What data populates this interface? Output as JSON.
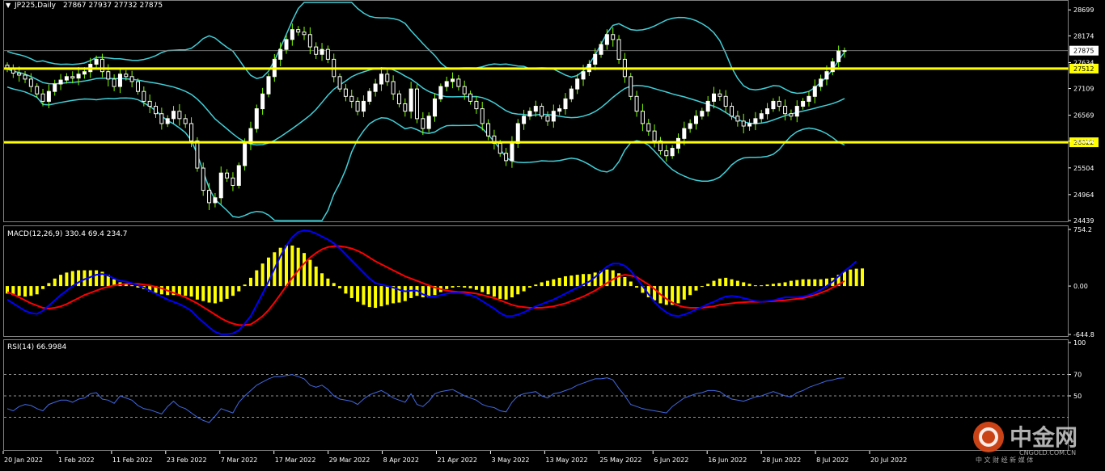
{
  "header": {
    "symbol": "JP225,Daily",
    "ohlc": "27867 27937 27732 27875",
    "macd_label": "MACD(12,26,9) 330.4 69.4 234.7",
    "rsi_label": "RSI(14) 66.9984"
  },
  "price_axis": {
    "ticks": [
      "28699",
      "28174",
      "27634",
      "27109",
      "26569",
      "26044",
      "25504",
      "24964",
      "24439"
    ],
    "current_price_label": "27875",
    "level_labels": [
      "27512",
      "26022"
    ]
  },
  "macd_axis": {
    "ticks": [
      "754.2",
      "0.00",
      "-644.8"
    ]
  },
  "rsi_axis": {
    "ticks": [
      "100",
      "70",
      "50"
    ]
  },
  "date_axis": {
    "labels": [
      "20 Jan 2022",
      "1 Feb 2022",
      "11 Feb 2022",
      "23 Feb 2022",
      "7 Mar 2022",
      "17 Mar 2022",
      "29 Mar 2022",
      "8 Apr 2022",
      "21 Apr 2022",
      "3 May 2022",
      "13 May 2022",
      "25 May 2022",
      "6 Jun 2022",
      "16 Jun 2022",
      "28 Jun 2022",
      "8 Jul 2022",
      "20 Jul 2022"
    ]
  },
  "watermark": {
    "brand": "中金网",
    "domain": "CNGOLD.COM.CN",
    "slogan": "中 文 财 经 新 媒 体"
  },
  "colors": {
    "background": "#000000",
    "bull": "#ffffff",
    "bear": "#ffffff",
    "wick": "#7fff00",
    "bollinger": "#40d0d8",
    "level_line": "#ffff00",
    "macd_hist": "#ffff00",
    "macd_line": "#0000ff",
    "signal_line": "#ff0000",
    "rsi_line": "#4169e1"
  },
  "chart_data": [
    {
      "type": "candlestick",
      "title": "JP225,Daily",
      "x_range": [
        "2022-01-20",
        "2022-07-22"
      ],
      "ylim": [
        24439,
        28850
      ],
      "horizontal_levels": [
        27512,
        26022
      ],
      "current_price": 27875,
      "last_bar": {
        "open": 27867,
        "high": 27937,
        "low": 27732,
        "close": 27875
      },
      "series": [
        {
          "name": "Close",
          "values": [
            27500,
            27420,
            27380,
            27300,
            27150,
            27000,
            26850,
            27050,
            27200,
            27280,
            27350,
            27320,
            27400,
            27450,
            27600,
            27700,
            27450,
            27300,
            27150,
            27400,
            27350,
            27250,
            27050,
            26850,
            26750,
            26600,
            26400,
            26500,
            26650,
            26500,
            26400,
            26050,
            25500,
            25050,
            24800,
            24900,
            25400,
            25300,
            25150,
            25550,
            26000,
            26300,
            26700,
            27000,
            27350,
            27700,
            27900,
            28100,
            28300,
            28250,
            28200,
            27950,
            27800,
            27900,
            27700,
            27350,
            27100,
            26950,
            26850,
            26650,
            26850,
            27050,
            27200,
            27400,
            27250,
            27000,
            26800,
            26650,
            27100,
            26500,
            26300,
            26550,
            26900,
            27150,
            27250,
            27300,
            27150,
            27000,
            26850,
            26700,
            26400,
            26150,
            26000,
            25800,
            25650,
            26000,
            26400,
            26550,
            26650,
            26750,
            26550,
            26450,
            26650,
            26700,
            26900,
            27100,
            27300,
            27450,
            27600,
            27800,
            28000,
            28200,
            28100,
            27700,
            27350,
            26950,
            26650,
            26400,
            26250,
            26050,
            25850,
            25750,
            25900,
            26100,
            26300,
            26400,
            26550,
            26650,
            26850,
            27000,
            26950,
            26750,
            26550,
            26450,
            26350,
            26400,
            26500,
            26600,
            26700,
            26850,
            26750,
            26600,
            26550,
            26750,
            26850,
            26950,
            27150,
            27300,
            27450,
            27650,
            27867,
            27875
          ]
        }
      ],
      "bollinger": {
        "period": 20,
        "deviations": 2
      }
    },
    {
      "type": "bar+line",
      "title": "MACD(12,26,9) 330.4 69.4 234.7",
      "ylim": [
        -644.8,
        754.2
      ],
      "series": [
        {
          "name": "MACD",
          "values": [
            -180,
            -230,
            -280,
            -330,
            -360,
            -370,
            -330,
            -260,
            -190,
            -120,
            -60,
            0,
            50,
            90,
            120,
            150,
            160,
            140,
            100,
            70,
            60,
            40,
            10,
            -20,
            -60,
            -100,
            -140,
            -180,
            -210,
            -240,
            -280,
            -330,
            -410,
            -480,
            -550,
            -610,
            -640,
            -640,
            -630,
            -590,
            -500,
            -400,
            -250,
            -100,
            60,
            230,
            400,
            540,
            650,
            720,
            740,
            730,
            700,
            660,
            620,
            570,
            500,
            420,
            340,
            260,
            180,
            100,
            40,
            20,
            0,
            -20,
            -50,
            -70,
            -60,
            -60,
            -110,
            -140,
            -140,
            -120,
            -100,
            -90,
            -90,
            -100,
            -120,
            -150,
            -200,
            -250,
            -300,
            -360,
            -400,
            -400,
            -380,
            -350,
            -310,
            -270,
            -240,
            -210,
            -180,
            -140,
            -100,
            -60,
            -20,
            20,
            60,
            120,
            190,
            260,
            300,
            300,
            270,
            200,
            100,
            0,
            -110,
            -210,
            -290,
            -350,
            -390,
            -400,
            -380,
            -350,
            -310,
            -280,
            -240,
            -210,
            -170,
            -140,
            -130,
            -140,
            -160,
            -180,
            -200,
            -210,
            -200,
            -190,
            -170,
            -150,
            -150,
            -150,
            -140,
            -120,
            -90,
            -50,
            0,
            60,
            130,
            200,
            260,
            330
          ]
        },
        {
          "name": "Signal",
          "values": [
            -80,
            -110,
            -150,
            -190,
            -230,
            -260,
            -290,
            -300,
            -290,
            -270,
            -240,
            -200,
            -160,
            -120,
            -90,
            -60,
            -30,
            -10,
            10,
            20,
            30,
            30,
            30,
            20,
            10,
            -10,
            -30,
            -60,
            -90,
            -120,
            -150,
            -190,
            -230,
            -280,
            -330,
            -380,
            -430,
            -470,
            -500,
            -520,
            -520,
            -510,
            -460,
            -400,
            -320,
            -220,
            -110,
            0,
            110,
            210,
            300,
            380,
            440,
            490,
            520,
            530,
            530,
            520,
            500,
            470,
            430,
            380,
            330,
            290,
            250,
            210,
            170,
            130,
            100,
            70,
            40,
            10,
            -20,
            -40,
            -60,
            -70,
            -80,
            -80,
            -90,
            -100,
            -120,
            -140,
            -160,
            -190,
            -220,
            -250,
            -270,
            -280,
            -290,
            -290,
            -290,
            -280,
            -270,
            -250,
            -230,
            -200,
            -170,
            -140,
            -100,
            -60,
            -10,
            40,
            90,
            130,
            150,
            140,
            120,
            70,
            20,
            -40,
            -110,
            -170,
            -220,
            -260,
            -280,
            -290,
            -290,
            -290,
            -280,
            -270,
            -250,
            -240,
            -230,
            -220,
            -215,
            -210,
            -210,
            -210,
            -205,
            -200,
            -195,
            -190,
            -180,
            -170,
            -160,
            -140,
            -120,
            -90,
            -60,
            -20,
            20,
            69
          ]
        },
        {
          "name": "Histogram",
          "values": [
            -100,
            -120,
            -130,
            -140,
            -130,
            -110,
            -40,
            40,
            100,
            150,
            180,
            200,
            210,
            210,
            210,
            210,
            190,
            150,
            90,
            50,
            30,
            10,
            -20,
            -40,
            -70,
            -90,
            -110,
            -120,
            -120,
            -120,
            -130,
            -140,
            -180,
            -200,
            -220,
            -230,
            -210,
            -170,
            -130,
            -70,
            20,
            110,
            210,
            300,
            380,
            450,
            510,
            540,
            540,
            510,
            440,
            350,
            260,
            170,
            100,
            40,
            -30,
            -100,
            -160,
            -210,
            -250,
            -280,
            -290,
            -270,
            -250,
            -230,
            -220,
            -200,
            -160,
            -130,
            -150,
            -150,
            -120,
            -80,
            -40,
            -20,
            -10,
            -20,
            -30,
            -50,
            -80,
            -110,
            -140,
            -170,
            -180,
            -150,
            -110,
            -70,
            -20,
            20,
            50,
            70,
            90,
            110,
            130,
            140,
            150,
            160,
            160,
            180,
            200,
            220,
            210,
            170,
            120,
            60,
            -20,
            -90,
            -150,
            -190,
            -230,
            -250,
            -250,
            -230,
            -180,
            -120,
            -60,
            -10,
            30,
            70,
            100,
            110,
            90,
            70,
            50,
            30,
            10,
            10,
            20,
            30,
            40,
            50,
            70,
            80,
            90,
            90,
            90,
            90,
            100,
            110,
            150,
            190,
            220,
            231,
            234.7
          ]
        }
      ]
    },
    {
      "type": "line",
      "title": "RSI(14) 66.9984",
      "ylim": [
        0,
        100
      ],
      "reference_lines": [
        70,
        50,
        30
      ],
      "series": [
        {
          "name": "RSI",
          "values": [
            38,
            36,
            40,
            42,
            41,
            38,
            36,
            42,
            44,
            46,
            46,
            44,
            47,
            48,
            52,
            53,
            47,
            46,
            43,
            50,
            48,
            46,
            41,
            38,
            37,
            35,
            33,
            40,
            45,
            40,
            38,
            34,
            30,
            27,
            25,
            31,
            38,
            36,
            34,
            44,
            50,
            55,
            60,
            63,
            66,
            68,
            68,
            69,
            70,
            68,
            66,
            60,
            58,
            60,
            56,
            50,
            47,
            46,
            45,
            42,
            47,
            51,
            53,
            55,
            52,
            48,
            46,
            44,
            52,
            42,
            40,
            45,
            52,
            54,
            55,
            56,
            53,
            50,
            48,
            46,
            42,
            40,
            39,
            36,
            35,
            44,
            50,
            52,
            53,
            54,
            50,
            48,
            52,
            53,
            55,
            57,
            60,
            62,
            64,
            66,
            66,
            67,
            65,
            57,
            50,
            42,
            40,
            38,
            37,
            36,
            35,
            34,
            40,
            44,
            48,
            50,
            52,
            53,
            55,
            55,
            54,
            50,
            47,
            46,
            45,
            47,
            49,
            50,
            52,
            54,
            52,
            50,
            49,
            53,
            55,
            58,
            60,
            62,
            64,
            65,
            66.5,
            67
          ]
        }
      ]
    }
  ]
}
